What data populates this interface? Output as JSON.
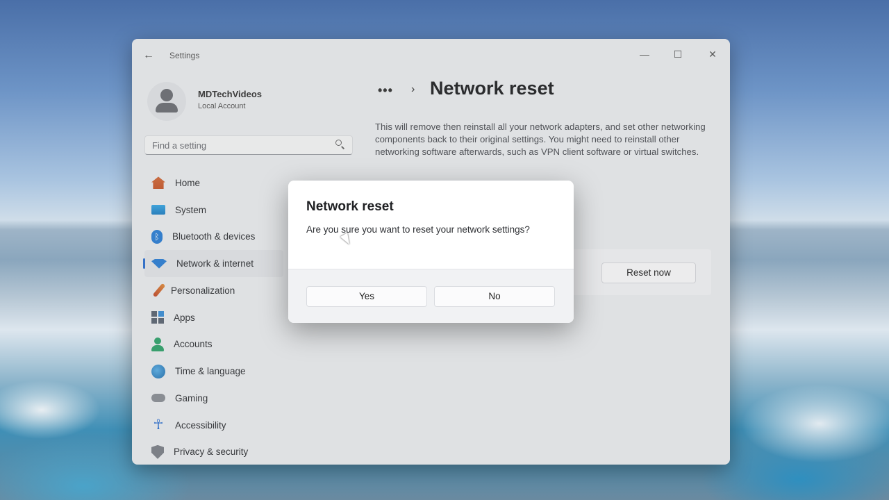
{
  "window": {
    "app_title": "Settings",
    "back_icon": "arrow-left-icon",
    "controls": {
      "minimize": "—",
      "maximize": "☐",
      "close": "✕"
    }
  },
  "profile": {
    "name": "MDTechVideos",
    "account_type": "Local Account"
  },
  "search": {
    "placeholder": "Find a setting"
  },
  "sidebar": {
    "items": [
      {
        "label": "Home",
        "icon": "home-icon"
      },
      {
        "label": "System",
        "icon": "monitor-icon"
      },
      {
        "label": "Bluetooth & devices",
        "icon": "bluetooth-icon"
      },
      {
        "label": "Network & internet",
        "icon": "wifi-icon",
        "active": true
      },
      {
        "label": "Personalization",
        "icon": "brush-icon"
      },
      {
        "label": "Apps",
        "icon": "apps-icon"
      },
      {
        "label": "Accounts",
        "icon": "person-icon"
      },
      {
        "label": "Time & language",
        "icon": "globe-clock-icon"
      },
      {
        "label": "Gaming",
        "icon": "gamepad-icon"
      },
      {
        "label": "Accessibility",
        "icon": "accessibility-icon"
      },
      {
        "label": "Privacy & security",
        "icon": "shield-icon"
      }
    ]
  },
  "main": {
    "breadcrumb_more": "•••",
    "breadcrumb_chevron": "›",
    "title": "Network reset",
    "description": "This will remove then reinstall all your network adapters, and set other networking components back to their original settings. You might need to reinstall other networking software afterwards, such as VPN client software or virtual switches.",
    "reset_button": "Reset now"
  },
  "dialog": {
    "title": "Network reset",
    "message": "Are you sure you want to reset your network settings?",
    "yes": "Yes",
    "no": "No"
  },
  "colors": {
    "accent": "#2b6fd1",
    "window_bg": "#eceef1",
    "dialog_bg": "#ffffff"
  }
}
